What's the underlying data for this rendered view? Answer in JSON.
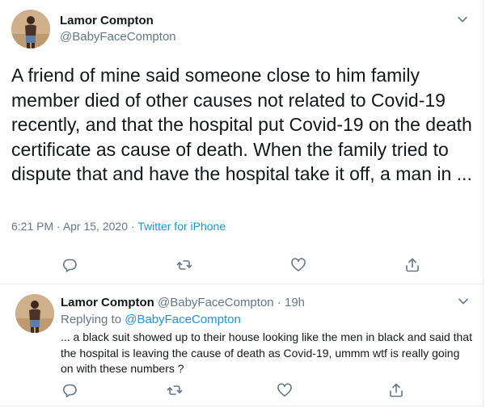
{
  "main_tweet": {
    "author_name": "Lamor Compton",
    "author_handle": "@BabyFaceCompton",
    "text": "A friend of mine said someone close to him family member died of other causes not related to Covid-19 recently, and that the hospital put Covid-19 on the death certificate as cause of death. When the family tried to dispute that and have the hospital take it off, a man in ...",
    "time": "6:21 PM",
    "separator": " · ",
    "date": "Apr 15, 2020",
    "source": "Twitter for iPhone"
  },
  "reply_tweet": {
    "author_name": "Lamor Compton",
    "author_handle": "@BabyFaceCompton",
    "dot": " · ",
    "age": "19h",
    "replying_label": "Replying to ",
    "replying_to": "@BabyFaceCompton",
    "text": "... a black suit showed up to their house looking like the men in black and said that the hospital is leaving the cause of death as Covid-19, ummm wtf is really going on with these numbers ?"
  },
  "icons": [
    "reply-icon",
    "retweet-icon",
    "like-icon",
    "share-icon",
    "chevron-down-icon"
  ],
  "colors": {
    "text": "#14171a",
    "secondary": "#657786",
    "link": "#1b95e0",
    "divider": "#e6ecf0"
  }
}
